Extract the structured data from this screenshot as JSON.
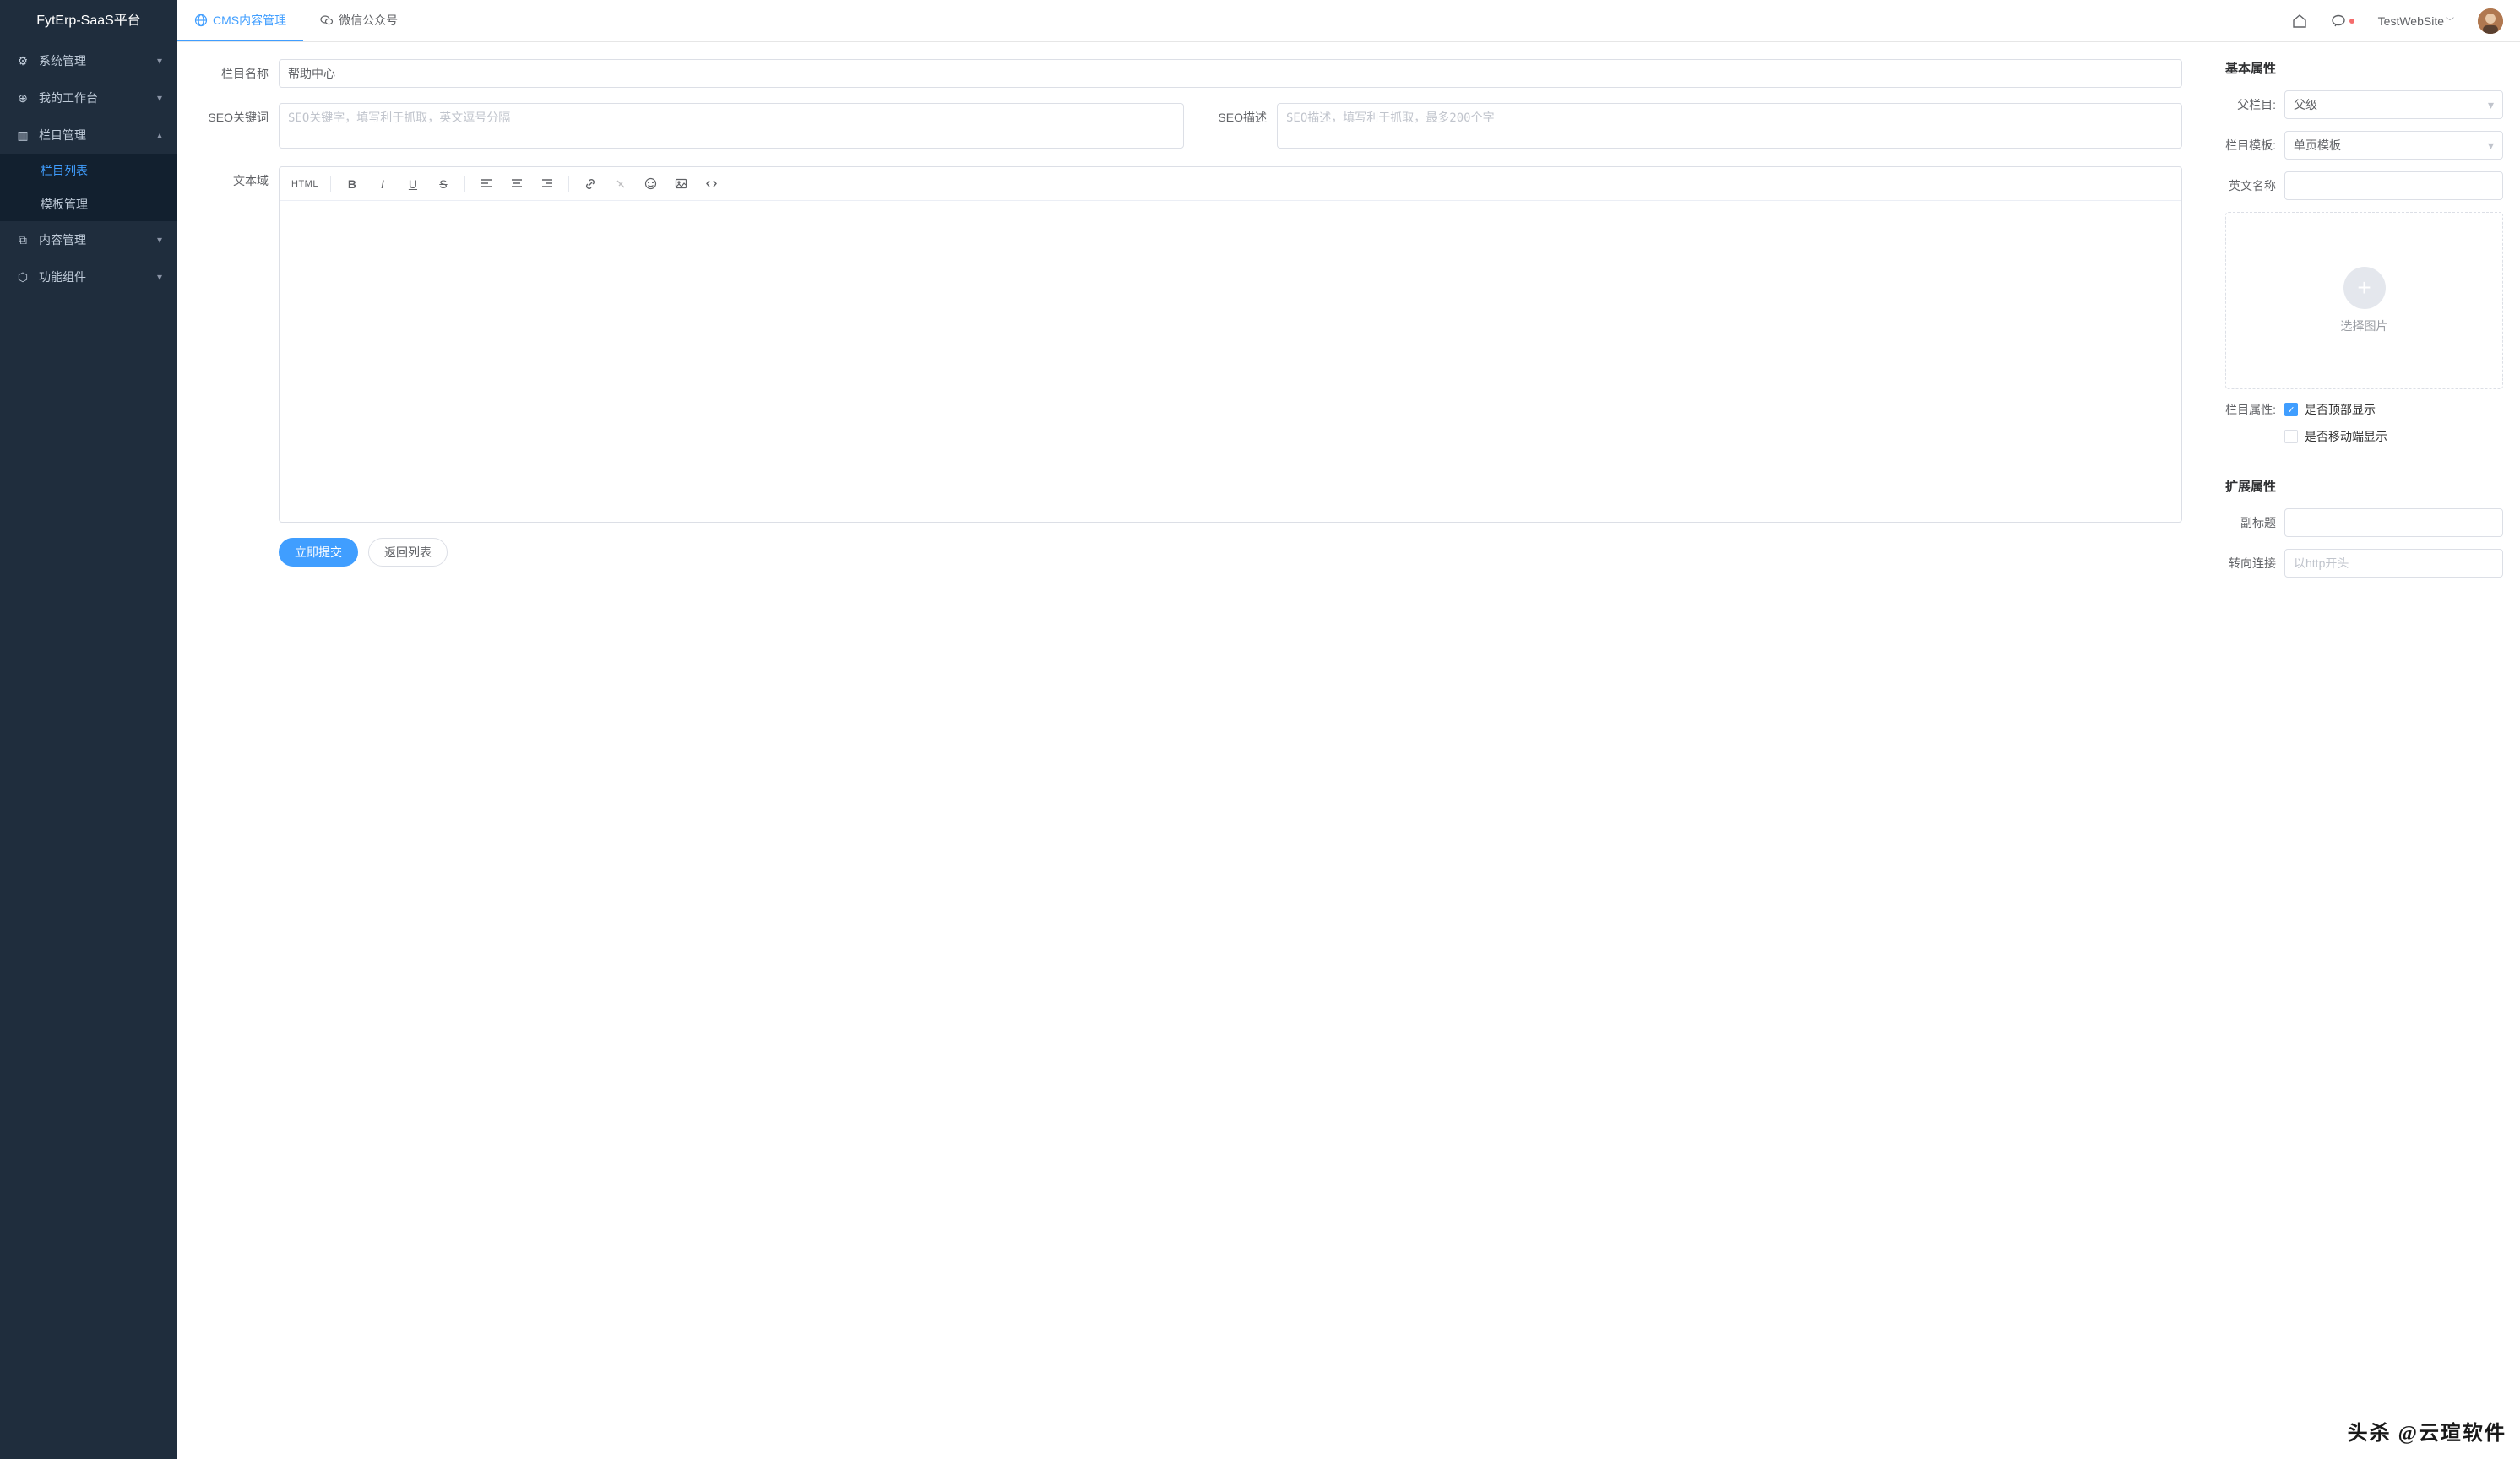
{
  "brand": "FytErp-SaaS平台",
  "sidebar": {
    "items": [
      {
        "icon": "gear",
        "label": "系统管理",
        "arrow": "down"
      },
      {
        "icon": "globe",
        "label": "我的工作台",
        "arrow": "down"
      },
      {
        "icon": "columns",
        "label": "栏目管理",
        "arrow": "up",
        "children": [
          {
            "label": "栏目列表",
            "active": true
          },
          {
            "label": "模板管理",
            "active": false
          }
        ]
      },
      {
        "icon": "doc",
        "label": "内容管理",
        "arrow": "down"
      },
      {
        "icon": "cube",
        "label": "功能组件",
        "arrow": "down"
      }
    ]
  },
  "topbar": {
    "tabs": [
      {
        "icon": "globe",
        "label": "CMS内容管理",
        "active": true
      },
      {
        "icon": "wechat",
        "label": "微信公众号",
        "active": false
      }
    ],
    "site_label": "TestWebSite"
  },
  "form": {
    "name_label": "栏目名称",
    "name_value": "帮助中心",
    "seo_kw_label": "SEO关键词",
    "seo_kw_placeholder": "SEO关键字，填写利于抓取，英文逗号分隔",
    "seo_desc_label": "SEO描述",
    "seo_desc_placeholder": "SEO描述，填写利于抓取，最多200个字",
    "editor_label": "文本域",
    "editor_html": "HTML",
    "submit": "立即提交",
    "back": "返回列表"
  },
  "props": {
    "basic_title": "基本属性",
    "parent_label": "父栏目:",
    "parent_value": "父级",
    "template_label": "栏目模板:",
    "template_value": "单页模板",
    "enname_label": "英文名称",
    "img_hint": "选择图片",
    "attr_label": "栏目属性:",
    "chk_top": "是否顶部显示",
    "chk_top_checked": true,
    "chk_mobile": "是否移动端显示",
    "chk_mobile_checked": false,
    "ext_title": "扩展属性",
    "subtitle_label": "副标题",
    "redirect_label": "转向连接",
    "redirect_placeholder": "以http开头"
  },
  "watermark": "头杀 @云瑄软件"
}
